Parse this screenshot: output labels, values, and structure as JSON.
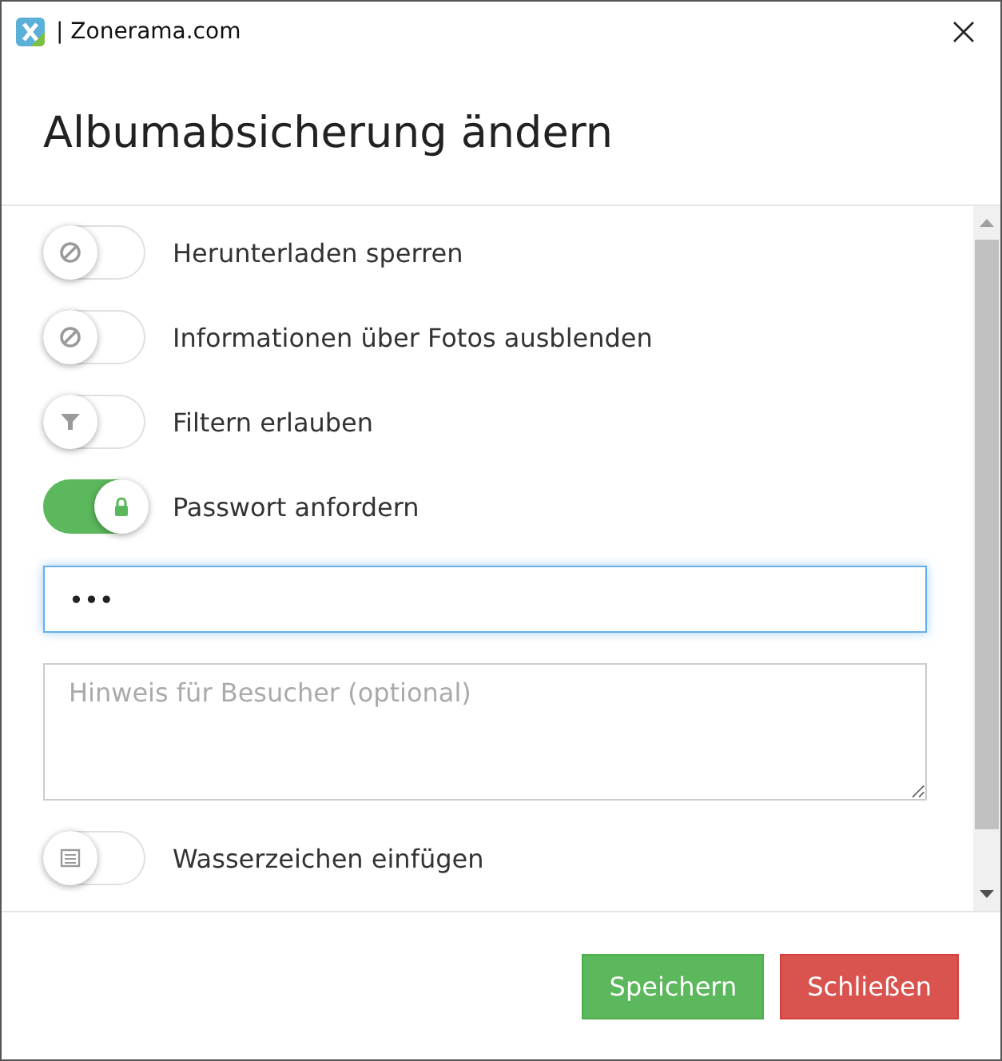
{
  "window": {
    "title": "| Zonerama.com"
  },
  "dialog": {
    "title": "Albumabsicherung ändern"
  },
  "options": [
    {
      "kind": "no-download",
      "label": "Herunterladen sperren",
      "on": false
    },
    {
      "kind": "no-info",
      "label": "Informationen über Fotos ausblenden",
      "on": false
    },
    {
      "kind": "filter",
      "label": "Filtern erlauben",
      "on": false
    },
    {
      "kind": "lock",
      "label": "Passwort anfordern",
      "on": true
    }
  ],
  "password": {
    "value": "•••"
  },
  "hint": {
    "placeholder": "Hinweis für Besucher (optional)"
  },
  "options_after": [
    {
      "kind": "watermark",
      "label": "Wasserzeichen einfügen",
      "on": false
    }
  ],
  "buttons": [
    {
      "kind": "primary",
      "label": "Speichern"
    },
    {
      "kind": "danger",
      "label": "Schließen"
    }
  ]
}
